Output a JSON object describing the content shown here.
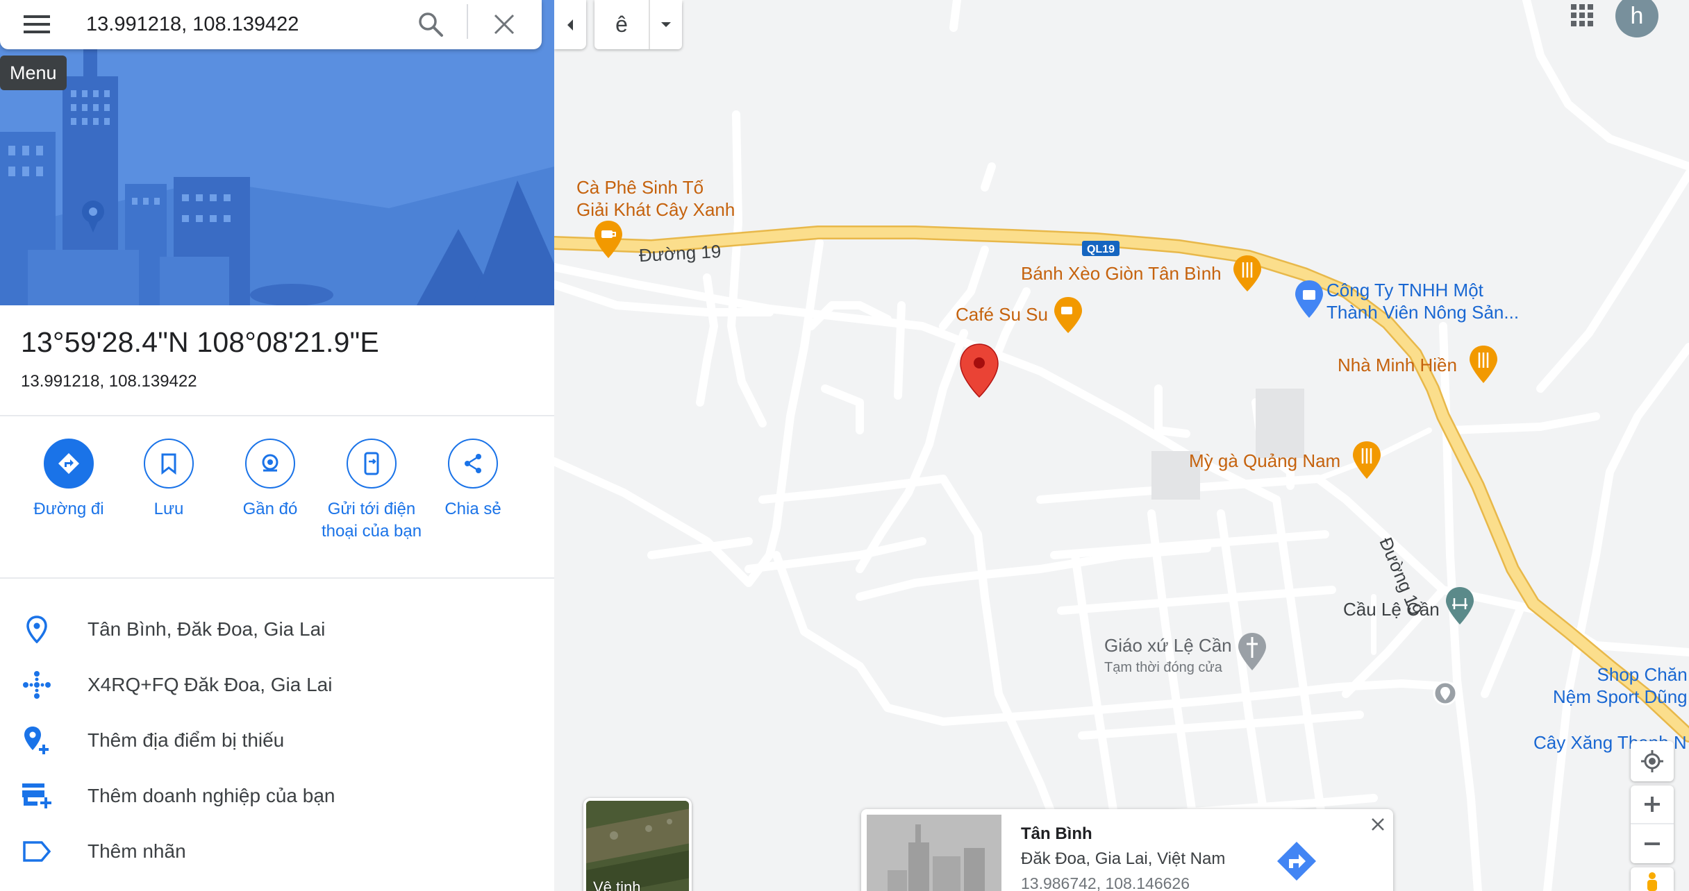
{
  "search": {
    "value": "13.991218, 108.139422",
    "menu_tooltip": "Menu"
  },
  "place": {
    "dms": "13°59'28.4\"N 108°08'21.9\"E",
    "decimal": "13.991218, 108.139422"
  },
  "actions": [
    {
      "label": "Đường đi",
      "icon": "directions-icon"
    },
    {
      "label": "Lưu",
      "icon": "bookmark-icon"
    },
    {
      "label": "Gần đó",
      "icon": "nearby-icon"
    },
    {
      "label": "Gửi tới điện thoại của bạn",
      "icon": "send-to-phone-icon"
    },
    {
      "label": "Chia sẻ",
      "icon": "share-icon"
    }
  ],
  "info_rows": [
    {
      "text": "Tân Bình, Đăk Đoa, Gia Lai",
      "icon": "location-pin-icon"
    },
    {
      "text": "X4RQ+FQ Đăk Đoa, Gia Lai",
      "icon": "plus-code-icon"
    },
    {
      "text": "Thêm địa điểm bị thiếu",
      "icon": "add-place-icon"
    },
    {
      "text": "Thêm doanh nghiệp của bạn",
      "icon": "add-business-icon"
    },
    {
      "text": "Thêm nhãn",
      "icon": "label-icon"
    }
  ],
  "map": {
    "ime_char": "ê",
    "avatar_letter": "h",
    "pois": {
      "cafe_cay_xanh": "Cà Phê Sinh Tố\nGiải Khát Cây Xanh",
      "banh_xeo": "Bánh Xèo Giòn Tân Bình",
      "cafe_su_su": "Café Su Su",
      "cong_ty": "Công Ty TNHH Một\nThành Viên Nông Sản...",
      "nha_minh_hien": "Nhà Minh Hiền",
      "my_ga": "Mỳ gà Quảng Nam",
      "cau_le_can": "Cầu Lệ Cần",
      "giao_xu": "Giáo xứ Lệ Cần",
      "giao_xu_status": "Tạm thời đóng cửa",
      "shop_chan": "Shop Chăn\nNệm Sport Dũng",
      "cay_xang": "Cây Xăng Thanh N"
    },
    "roads": {
      "duong19_a": "Đường 19",
      "duong19_b": "Đường 19",
      "ql19": "QL19"
    },
    "satellite_label": "Vệ tinh",
    "card": {
      "name": "Tân Bình",
      "address": "Đăk Đoa, Gia Lai, Việt Nam",
      "coords": "13.986742, 108.146626"
    }
  },
  "colors": {
    "accent": "#1a73e8",
    "highway": "#f8d27a",
    "poi_food": "#c5620d",
    "pin": "#ea4335"
  }
}
